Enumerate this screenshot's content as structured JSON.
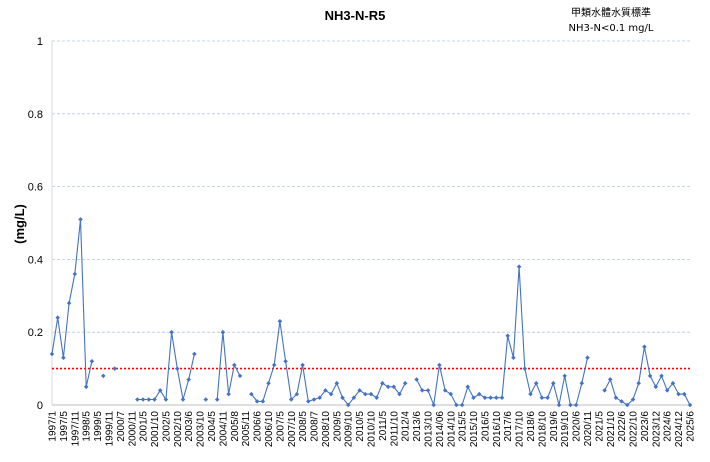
{
  "chart_data": {
    "type": "line",
    "title": "NH3-N-R5",
    "standard_title": "甲類水體水質標準",
    "standard_subtitle": "NH3-N<0.1 mg/L",
    "ylabel": "(mg/L)",
    "xlabel": "",
    "ylim": [
      0,
      1
    ],
    "yticks": [
      "0",
      "0.2",
      "0.4",
      "0.6",
      "0.8",
      "1"
    ],
    "grid": true,
    "legend": "none",
    "standard_value": 0.1,
    "colors": {
      "series": "#4472C4",
      "standard": "#FF0000",
      "grid": "#B4C6E7"
    },
    "categories": [
      "1997/1",
      "1997/5",
      "1997/11",
      "1998/5",
      "1999/5",
      "1999/11",
      "2000/7",
      "2000/11",
      "2001/5",
      "2001/10",
      "2002/5",
      "2002/10",
      "2003/6",
      "2003/10",
      "2004/5",
      "2004/11",
      "2005/8",
      "2005/11",
      "2006/6",
      "2006/10",
      "2007/5",
      "2007/10",
      "2008/5",
      "2008/7",
      "2008/10",
      "2009/5",
      "2009/10",
      "2010/5",
      "2010/10",
      "2011/5",
      "2011/10",
      "2012/4",
      "2013/6",
      "2013/10",
      "2014/06",
      "2014/10",
      "2015/5",
      "2015/10",
      "2016/5",
      "2016/10",
      "2017/6",
      "2017/10",
      "2018/6",
      "2018/10",
      "2019/6",
      "2019/10",
      "2020/6",
      "2020/11",
      "2021/5",
      "2021/10",
      "2022/6",
      "2022/10",
      "2023/6",
      "2023/12",
      "2024/6",
      "2024/12",
      "2025/6"
    ],
    "segments": [
      [
        [
          0,
          0.14
        ],
        [
          1,
          0.24
        ],
        [
          2,
          0.13
        ],
        [
          3,
          0.28
        ],
        [
          4,
          0.36
        ],
        [
          5,
          0.51
        ],
        [
          6,
          0.05
        ],
        [
          7,
          0.12
        ]
      ],
      [
        [
          9,
          0.08
        ]
      ],
      [
        [
          11,
          0.1
        ]
      ],
      [
        [
          15,
          0.015
        ],
        [
          16,
          0.015
        ],
        [
          17,
          0.015
        ],
        [
          18,
          0.015
        ],
        [
          19,
          0.04
        ],
        [
          20,
          0.015
        ],
        [
          21,
          0.2
        ],
        [
          22,
          0.1
        ],
        [
          23,
          0.015
        ],
        [
          24,
          0.07
        ],
        [
          25,
          0.14
        ]
      ],
      [
        [
          27,
          0.015
        ]
      ],
      [
        [
          29,
          0.015
        ],
        [
          30,
          0.2
        ],
        [
          31,
          0.03
        ],
        [
          32,
          0.11
        ],
        [
          33,
          0.08
        ]
      ],
      [
        [
          35,
          0.03
        ],
        [
          36,
          0.01
        ],
        [
          37,
          0.01
        ],
        [
          38,
          0.06
        ],
        [
          39,
          0.11
        ],
        [
          40,
          0.23
        ],
        [
          41,
          0.12
        ],
        [
          42,
          0.015
        ],
        [
          43,
          0.03
        ],
        [
          44,
          0.11
        ],
        [
          45,
          0.01
        ],
        [
          46,
          0.015
        ],
        [
          47,
          0.02
        ],
        [
          48,
          0.04
        ],
        [
          49,
          0.03
        ],
        [
          50,
          0.06
        ],
        [
          51,
          0.02
        ],
        [
          52,
          0.0
        ],
        [
          53,
          0.02
        ],
        [
          54,
          0.04
        ],
        [
          55,
          0.03
        ],
        [
          56,
          0.03
        ],
        [
          57,
          0.02
        ],
        [
          58,
          0.06
        ],
        [
          59,
          0.05
        ],
        [
          60,
          0.05
        ],
        [
          61,
          0.03
        ],
        [
          62,
          0.06
        ]
      ],
      [
        [
          64,
          0.07
        ],
        [
          65,
          0.04
        ],
        [
          66,
          0.04
        ],
        [
          67,
          0.0
        ],
        [
          68,
          0.11
        ],
        [
          69,
          0.04
        ],
        [
          70,
          0.03
        ],
        [
          71,
          0.0
        ],
        [
          72,
          0.0
        ],
        [
          73,
          0.05
        ],
        [
          74,
          0.02
        ],
        [
          75,
          0.03
        ],
        [
          76,
          0.02
        ],
        [
          77,
          0.02
        ],
        [
          78,
          0.02
        ],
        [
          79,
          0.02
        ],
        [
          80,
          0.19
        ],
        [
          81,
          0.13
        ],
        [
          82,
          0.38
        ],
        [
          83,
          0.1
        ],
        [
          84,
          0.03
        ],
        [
          85,
          0.06
        ],
        [
          86,
          0.02
        ],
        [
          87,
          0.02
        ],
        [
          88,
          0.06
        ],
        [
          89,
          0.0
        ],
        [
          90,
          0.08
        ],
        [
          91,
          0.0
        ],
        [
          92,
          0.0
        ],
        [
          93,
          0.06
        ],
        [
          94,
          0.13
        ]
      ],
      [
        [
          97,
          0.04
        ],
        [
          98,
          0.07
        ],
        [
          99,
          0.02
        ],
        [
          100,
          0.01
        ],
        [
          101,
          0.0
        ],
        [
          102,
          0.015
        ],
        [
          103,
          0.06
        ],
        [
          104,
          0.16
        ],
        [
          105,
          0.08
        ],
        [
          106,
          0.05
        ],
        [
          107,
          0.08
        ],
        [
          108,
          0.04
        ],
        [
          109,
          0.06
        ],
        [
          110,
          0.03
        ],
        [
          111,
          0.03
        ],
        [
          112,
          0.0
        ]
      ]
    ],
    "x_index_max": 112
  }
}
